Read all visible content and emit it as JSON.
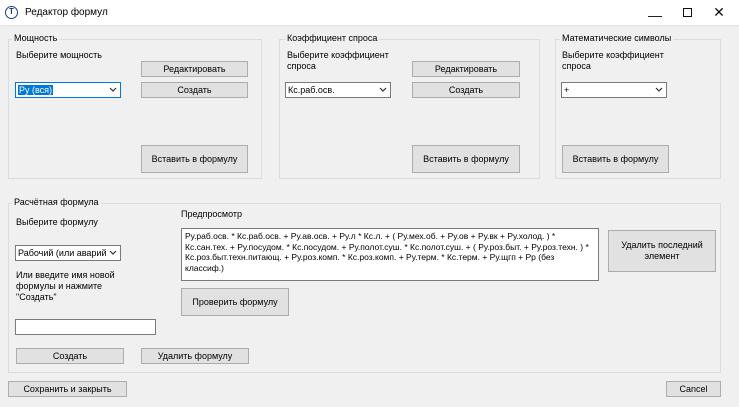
{
  "window": {
    "title": "Редактор формул",
    "app_icon_glyph": "T",
    "minimize_glyph": "—",
    "close_glyph": "✕"
  },
  "power": {
    "group_title": "Мощность",
    "select_label": "Выберите мощность",
    "selected": "Ру (вся)",
    "edit_label": "Редактировать",
    "create_label": "Создать",
    "insert_label": "Вставить в формулу"
  },
  "demand": {
    "group_title": "Коэффициент спроса",
    "select_label": "Выберите коэффициент спроса",
    "selected": "Кс.раб.осв.",
    "edit_label": "Редактировать",
    "create_label": "Создать",
    "insert_label": "Вставить в формулу"
  },
  "math": {
    "group_title": "Математические символы",
    "select_label": "Выберите коэффициент спроса",
    "selected": "+",
    "insert_label": "Вставить в формулу"
  },
  "calc": {
    "group_title": "Расчётная формула",
    "select_label": "Выберите формулу",
    "selected": "Рабочий (или аварийн",
    "new_name_label": "Или введите имя новой формулы и нажмите \"Создать\"",
    "new_name_value": "",
    "preview_label": "Предпросмотр",
    "preview_text": "Ру.раб.осв. * Кс.раб.осв. + Ру.ав.осв. + Ру.л * Кс.л. + ( Ру.мех.об. + Ру.ов + Ру.вк + Ру.холод. ) * Кс.сан.тех. + Ру.посудом. * Кс.посудом. + Ру.полот.суш. * Кс.полот.суш. + ( Ру.роз.быт. + Ру.роз.техн. ) * Кс.роз.быт.техн.питающ. + Ру.роз.комп. * Кс.роз.комп. + Ру.терм. * Кс.терм. + Ру.щгп + Рр (без классиф.)",
    "delete_last_label": "Удалить последний элемент",
    "check_label": "Проверить формулу",
    "create_label": "Создать",
    "delete_formula_label": "Удалить формулу"
  },
  "footer": {
    "save_close_label": "Сохранить и закрыть",
    "cancel_label": "Cancel"
  },
  "colors": {
    "selection": "#0078d7",
    "button_face": "#e1e1e1",
    "window_bg": "#f0f0f0"
  }
}
